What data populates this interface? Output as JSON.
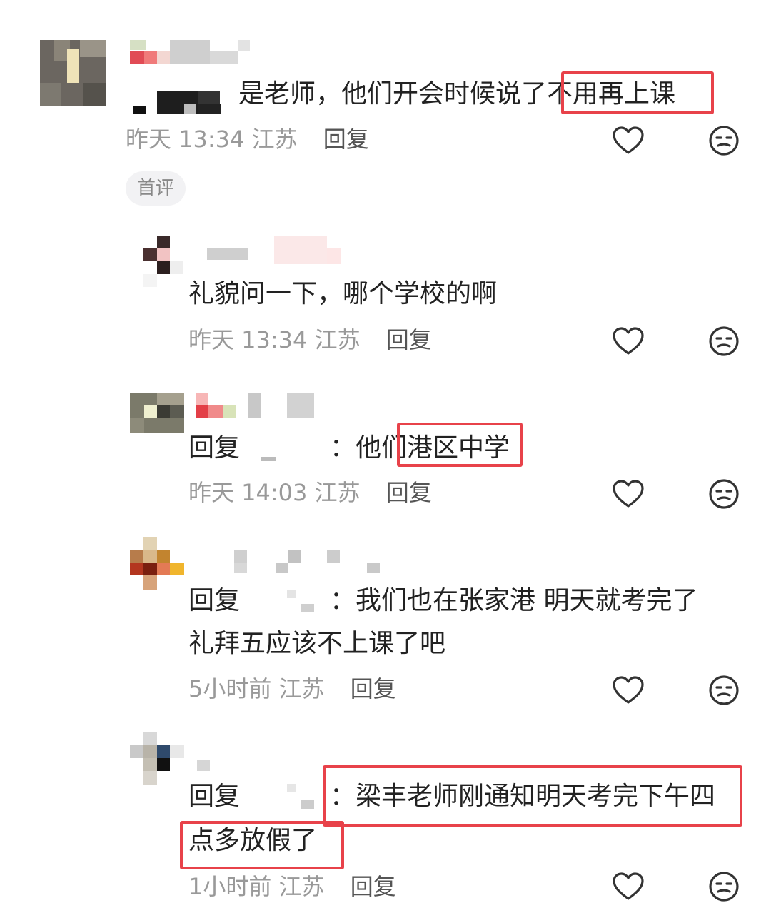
{
  "comments": [
    {
      "text": "是老师，他们开会时候说了不用再上课",
      "highlight": "不用再上课",
      "time": "昨天 13:34",
      "location": "江苏",
      "reply_label": "回复",
      "badge": "首评"
    },
    {
      "text": "礼貌问一下，哪个学校的啊",
      "time": "昨天 13:34",
      "location": "江苏",
      "reply_label": "回复"
    },
    {
      "reply_prefix": "回复",
      "text_before": "：他们",
      "highlight": "港区中学",
      "time": "昨天 14:03",
      "location": "江苏",
      "reply_label": "回复"
    },
    {
      "reply_prefix": "回复",
      "line1": "：我们也在张家港 明天就考完了",
      "line2": "礼拜五应该不上课了吧",
      "time": "5小时前",
      "location": "江苏",
      "reply_label": "回复"
    },
    {
      "reply_prefix": "回复",
      "line1": "：梁丰老师刚通知明天考完下午四",
      "line2": "点多放假了",
      "time": "1小时前",
      "location": "江苏",
      "reply_label": "回复"
    }
  ],
  "icons": {
    "like": "heart-icon",
    "dislike": "meh-face-icon"
  },
  "colors": {
    "highlight_border": "#e8424a",
    "meta": "#999999"
  }
}
